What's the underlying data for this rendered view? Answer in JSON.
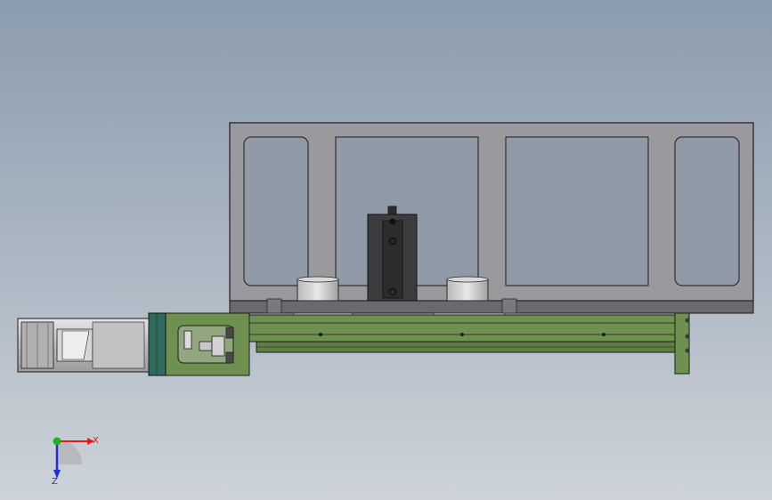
{
  "viewport": {
    "background_top": "#8b9cae",
    "background_bottom": "#cdd3d9"
  },
  "model": {
    "frame_color": "#9a9a9e",
    "base_color": "#6f9150",
    "motor_color": "#c8c8c8",
    "coupling_color": "#2f6a5c",
    "block_color": "#3c3c3e"
  },
  "triad": {
    "x_label": "X",
    "z_label": "Z",
    "x_color": "#e01c1c",
    "y_color": "#20b020",
    "z_color": "#2030d0"
  }
}
